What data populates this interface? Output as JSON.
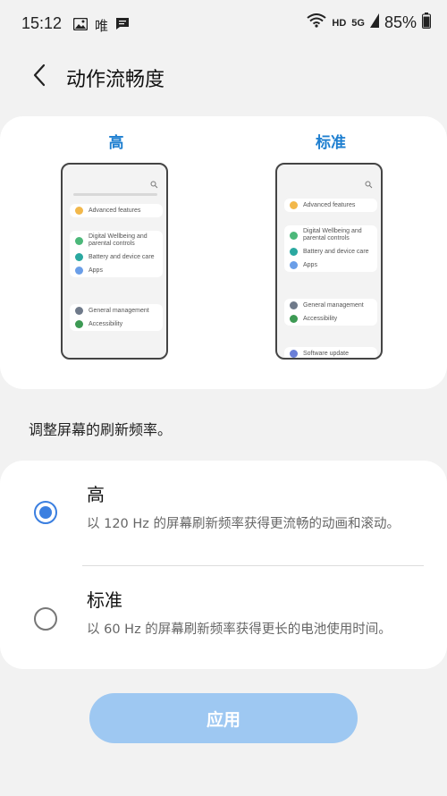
{
  "status_bar": {
    "time": "15:12",
    "carrier": "唯",
    "hd": "HD",
    "network": "5G",
    "battery": "85%"
  },
  "header": {
    "title": "动作流畅度"
  },
  "preview": {
    "left_label": "高",
    "right_label": "标准",
    "left_items": {
      "group1": [
        "Advanced features"
      ],
      "group2": [
        "Digital Wellbeing and parental controls",
        "Battery and device care",
        "Apps"
      ],
      "group3": [
        "General management",
        "Accessibility"
      ]
    },
    "right_items": {
      "group1": [
        "Advanced features"
      ],
      "group2": [
        "Digital Wellbeing and parental controls",
        "Battery and device care",
        "Apps"
      ],
      "group3": [
        "General management",
        "Accessibility"
      ],
      "group4": [
        "Software update"
      ]
    }
  },
  "description": "调整屏幕的刷新频率。",
  "options": [
    {
      "title": "高",
      "description": "以 120 Hz 的屏幕刷新频率获得更流畅的动画和滚动。",
      "selected": true
    },
    {
      "title": "标准",
      "description": "以 60 Hz 的屏幕刷新频率获得更长的电池使用时间。",
      "selected": false
    }
  ],
  "apply_button": {
    "label": "应用",
    "enabled": false
  },
  "colors": {
    "accent": "#3b7fe0",
    "preview_label": "#1e7fd0",
    "apply_disabled": "#9ec8f2"
  }
}
